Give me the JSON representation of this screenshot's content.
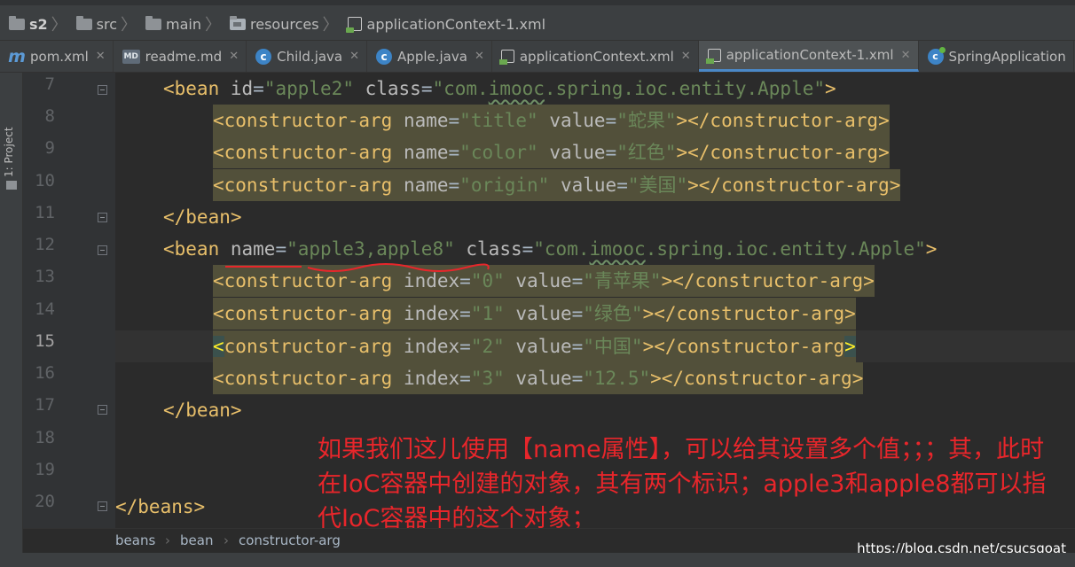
{
  "breadcrumb": {
    "items": [
      "s2",
      "src",
      "main",
      "resources",
      "applicationContext-1.xml"
    ]
  },
  "tabs": [
    {
      "label": "pom.xml",
      "icon": "maven-icon",
      "active": false
    },
    {
      "label": "readme.md",
      "icon": "markdown-icon",
      "active": false
    },
    {
      "label": "Child.java",
      "icon": "class-icon",
      "active": false
    },
    {
      "label": "Apple.java",
      "icon": "class-icon",
      "active": false
    },
    {
      "label": "applicationContext.xml",
      "icon": "xml-icon",
      "active": false
    },
    {
      "label": "applicationContext-1.xml",
      "icon": "xml-icon",
      "active": true
    },
    {
      "label": "SpringApplication",
      "icon": "spring-class-icon",
      "active": false
    }
  ],
  "side_panel": {
    "label": "1: Project"
  },
  "gutter": {
    "line_numbers": [
      "7",
      "8",
      "9",
      "10",
      "11",
      "12",
      "13",
      "14",
      "15",
      "16",
      "17",
      "18",
      "19",
      "20"
    ],
    "current_line": "15"
  },
  "code": {
    "l7": {
      "open": "<bean ",
      "attr1": "id",
      "eq1": "=",
      "val1": "\"apple2\"",
      "attr2": " class",
      "eq2": "=",
      "val2a": "\"com.",
      "val2b": "imooc",
      "val2c": ".spring.ioc.entity.Apple\"",
      "close": ">"
    },
    "l8": {
      "open": "<constructor-arg ",
      "attr1": "name",
      "val1": "\"title\"",
      "attr2": " value",
      "val2": "\"蛇果\"",
      "close": "></constructor-arg>"
    },
    "l9": {
      "open": "<constructor-arg ",
      "attr1": "name",
      "val1": "\"color\"",
      "attr2": " value",
      "val2": "\"红色\"",
      "close": "></constructor-arg>"
    },
    "l10": {
      "open": "<constructor-arg ",
      "attr1": "name",
      "val1": "\"origin\"",
      "attr2": " value",
      "val2": "\"美国\"",
      "close": "></constructor-arg>"
    },
    "l11": {
      "text": "</bean>"
    },
    "l12": {
      "open": "<bean ",
      "attr1": "name",
      "val1": "\"apple3,apple8\"",
      "attr2": " class",
      "val2a": "\"com.",
      "val2b": "imooc",
      "val2c": ".spring.ioc.entity.Apple\"",
      "close": ">"
    },
    "l13": {
      "open": "<constructor-arg ",
      "attr1": "index",
      "val1": "\"0\"",
      "attr2": " value",
      "val2": "\"青苹果\"",
      "close": "></constructor-arg>"
    },
    "l14": {
      "open": "<constructor-arg ",
      "attr1": "index",
      "val1": "\"1\"",
      "attr2": " value",
      "val2": "\"绿色\"",
      "close": "></constructor-arg>"
    },
    "l15": {
      "open_bracket": "<",
      "open": "constructor-arg ",
      "attr1": "index",
      "val1": "\"2\"",
      "attr2": " value",
      "val2": "\"中国\"",
      "close": "></constructor-arg",
      "close_bracket": ">"
    },
    "l16": {
      "open": "<constructor-arg ",
      "attr1": "index",
      "val1": "\"3\"",
      "attr2": " value",
      "val2": "\"12.5\"",
      "close": "></constructor-arg>"
    },
    "l17": {
      "text": "</bean>"
    },
    "l20": {
      "text": "</beans>"
    }
  },
  "annotation": {
    "text": "如果我们这儿使用【name属性】，可以给其设置多个值；；；其，此时在IoC容器中创建的对象，其有两个标识；apple3和apple8都可以指代IoC容器中的这个对象；"
  },
  "status_breadcrumb": [
    "beans",
    "bean",
    "constructor-arg"
  ],
  "watermark": "https://blog.csdn.net/csucsgoat",
  "colors": {
    "background": "#2b2b2b",
    "tag": "#e8bf6a",
    "attribute": "#bababa",
    "value": "#6a8759",
    "highlight": "#52503a",
    "annotation": "#e8262b",
    "active_tab_underline": "#4a88c7"
  }
}
